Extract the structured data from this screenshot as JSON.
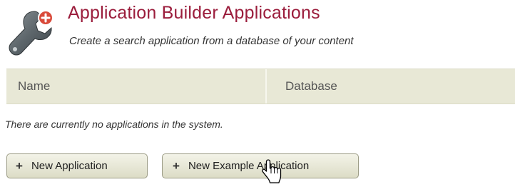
{
  "header": {
    "title": "Application Builder Applications",
    "subtitle": "Create a search application from a database of your content",
    "icon": "wrench-icon"
  },
  "table": {
    "columns": [
      "Name",
      "Database"
    ],
    "rows": [],
    "empty_message": "There are currently no applications in the system."
  },
  "actions": {
    "new_application_label": "New Application",
    "new_example_application_label": "New Example Application",
    "icon": "plus-icon"
  },
  "colors": {
    "title": "#9b1d3c",
    "header_row": "#e8e8d6",
    "icon_badge": "#d94a3a"
  },
  "cursor": "hand-pointer-icon"
}
